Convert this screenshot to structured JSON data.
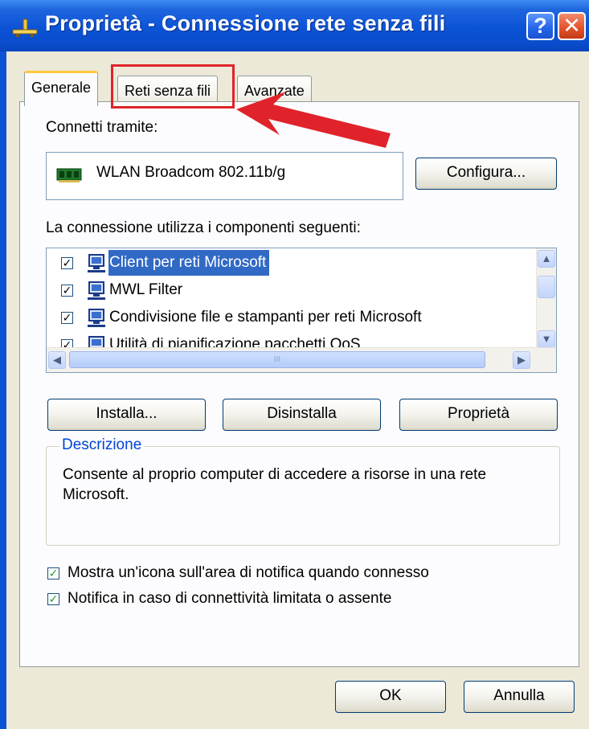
{
  "window": {
    "title": "Proprietà - Connessione rete senza fili",
    "help_glyph": "?",
    "close_glyph": "✕"
  },
  "tabs": [
    {
      "label": "Generale",
      "active": true
    },
    {
      "label": "Reti senza fili",
      "active": false
    },
    {
      "label": "Avanzate",
      "active": false
    }
  ],
  "connect": {
    "label": "Connetti tramite:",
    "adapter": "WLAN Broadcom 802.11b/g",
    "adapter_icon": "network-card-icon",
    "configure_button": "Configura..."
  },
  "components": {
    "label": "La connessione utilizza i componenti seguenti:",
    "items": [
      {
        "name": "Client per reti Microsoft",
        "checked": true,
        "selected": true,
        "icon": "network-computer-icon"
      },
      {
        "name": "MWL Filter",
        "checked": true,
        "selected": false,
        "icon": "network-computer-icon"
      },
      {
        "name": "Condivisione file e stampanti per reti Microsoft",
        "checked": true,
        "selected": false,
        "icon": "network-computer-icon"
      },
      {
        "name": "Utilità di pianificazione pacchetti QoS",
        "checked": true,
        "selected": false,
        "icon": "network-computer-icon"
      }
    ],
    "scroll_up": "▲",
    "scroll_down": "▼",
    "scroll_left": "◀",
    "scroll_right": "▶",
    "scroll_grip": "III"
  },
  "buttons": {
    "install": "Installa...",
    "uninstall": "Disinstalla",
    "properties": "Proprietà",
    "ok": "OK",
    "cancel": "Annulla"
  },
  "description": {
    "legend": "Descrizione",
    "text": "Consente al proprio computer di accedere a risorse in una rete Microsoft."
  },
  "options": [
    {
      "label": "Mostra un'icona sull'area di notifica quando connesso",
      "checked": true
    },
    {
      "label": "Notifica in caso di connettività limitata o assente",
      "checked": true
    }
  ],
  "check_glyph": "✓",
  "colors": {
    "title_blue": "#0a53d6",
    "selection": "#316ac5",
    "annotation_red": "#e0232a",
    "dialog_face": "#ece9d8"
  }
}
